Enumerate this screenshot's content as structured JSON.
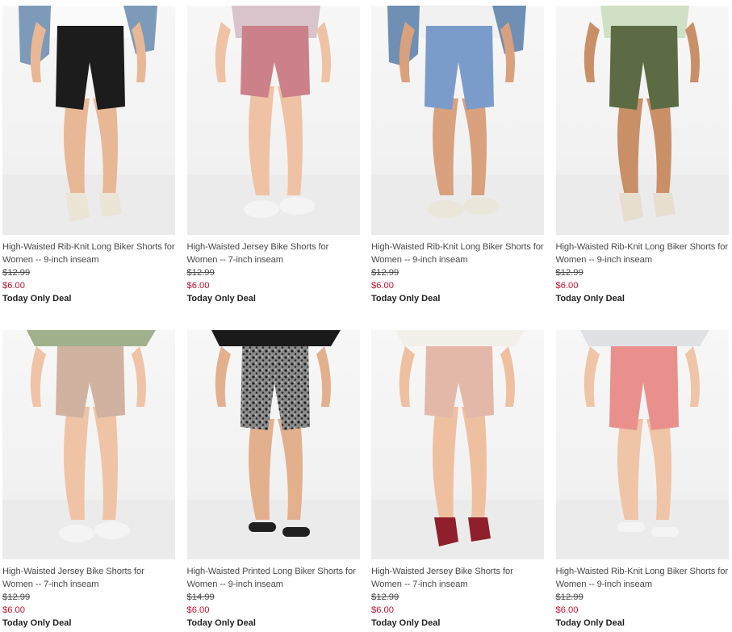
{
  "products": [
    {
      "name": "High-Waisted Rib-Knit Long Biker Shorts for Women -- 9-inch inseam",
      "original_price": "$12.99",
      "sale_price": "$6.00",
      "deal_label": "Today Only Deal",
      "shorts_color": "#1c1c1c",
      "top_color": "#fafafa",
      "jacket_color": "#7d9ab8",
      "skin_color": "#e8b796",
      "shoe_color": "#ece4d4",
      "photo_icon": "model-wearing-black-shorts"
    },
    {
      "name": "High-Waisted Jersey Bike Shorts for Women -- 7-inch inseam",
      "original_price": "$12.99",
      "sale_price": "$6.00",
      "deal_label": "Today Only Deal",
      "shorts_color": "#cc8089",
      "top_color": "#d9c4cc",
      "jacket_color": "",
      "skin_color": "#efc2a5",
      "shoe_color": "#f4f4f4",
      "photo_icon": "model-wearing-pink-shorts"
    },
    {
      "name": "High-Waisted Rib-Knit Long Biker Shorts for Women -- 9-inch inseam",
      "original_price": "$12.99",
      "sale_price": "$6.00",
      "deal_label": "Today Only Deal",
      "shorts_color": "#7b9ccb",
      "top_color": "#f1f1f1",
      "jacket_color": "#6f8fb5",
      "skin_color": "#d9a17d",
      "shoe_color": "#ebe6da",
      "photo_icon": "model-wearing-blue-shorts"
    },
    {
      "name": "High-Waisted Rib-Knit Long Biker Shorts for Women -- 9-inch inseam",
      "original_price": "$12.99",
      "sale_price": "$6.00",
      "deal_label": "Today Only Deal",
      "shorts_color": "#5d6b45",
      "top_color": "#cfe0c4",
      "jacket_color": "",
      "skin_color": "#c98f67",
      "shoe_color": "#e7ded0",
      "photo_icon": "model-wearing-olive-shorts"
    },
    {
      "name": "High-Waisted Jersey Bike Shorts for Women -- 7-inch inseam",
      "original_price": "$12.99",
      "sale_price": "$6.00",
      "deal_label": "Today Only Deal",
      "shorts_color": "#cfb3a0",
      "top_color": "#9fb08c",
      "jacket_color": "",
      "skin_color": "#efc4a6",
      "shoe_color": "#f4f4f4",
      "photo_icon": "model-wearing-tan-shorts"
    },
    {
      "name": "High-Waisted Printed Long Biker Shorts for Women -- 9-inch inseam",
      "original_price": "$14.99",
      "sale_price": "$6.00",
      "deal_label": "Today Only Deal",
      "shorts_color": "#4a4a4a",
      "top_color": "#1a1a1a",
      "jacket_color": "",
      "skin_color": "#e3b08e",
      "shoe_color": "#202020",
      "photo_icon": "model-wearing-print-shorts"
    },
    {
      "name": "High-Waisted Jersey Bike Shorts for Women -- 7-inch inseam",
      "original_price": "$12.99",
      "sale_price": "$6.00",
      "deal_label": "Today Only Deal",
      "shorts_color": "#e4b8a8",
      "top_color": "#f3efe9",
      "jacket_color": "",
      "skin_color": "#efc0a0",
      "shoe_color": "#8e1f2b",
      "photo_icon": "model-wearing-blush-shorts"
    },
    {
      "name": "High-Waisted Rib-Knit Long Biker Shorts for Women -- 9-inch inseam",
      "original_price": "$12.99",
      "sale_price": "$6.00",
      "deal_label": "Today Only Deal",
      "shorts_color": "#e9908c",
      "top_color": "#dfe1e4",
      "jacket_color": "",
      "skin_color": "#f0c4a7",
      "shoe_color": "#f4f4f4",
      "photo_icon": "model-wearing-coral-shorts"
    }
  ]
}
